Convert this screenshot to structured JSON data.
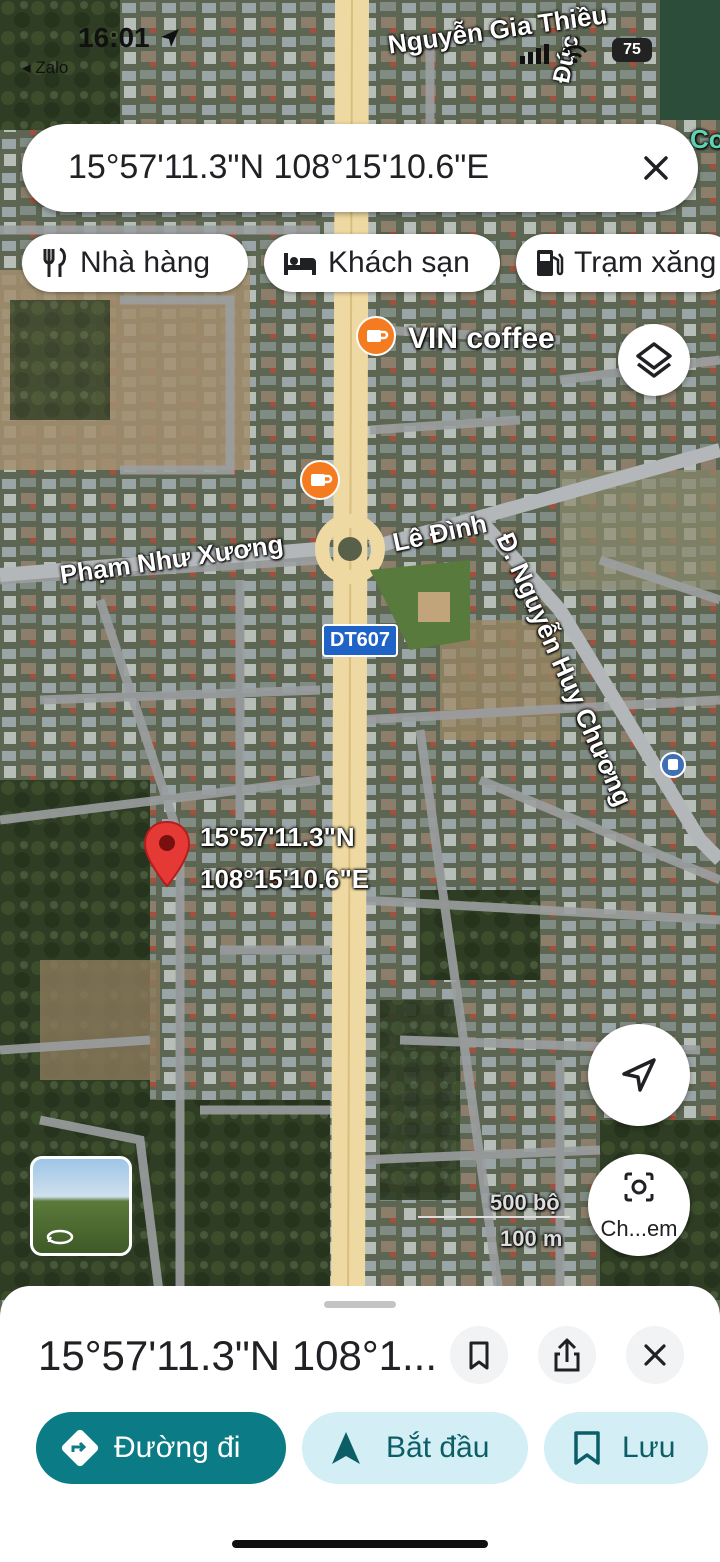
{
  "status_bar": {
    "time": "16:01",
    "back_app": "◂ Zalo",
    "battery": "75"
  },
  "search": {
    "query": "15°57'11.3\"N 108°15'10.6\"E"
  },
  "chips": [
    {
      "label": "Nhà hàng",
      "icon": "restaurant-icon"
    },
    {
      "label": "Khách sạn",
      "icon": "hotel-icon"
    },
    {
      "label": "Trạm xăng",
      "icon": "gas-station-icon"
    }
  ],
  "map": {
    "labels": {
      "street_top": "Nguyễn Gia Thiều",
      "street_top_right": "Đức",
      "street_left": "Phạm Như Xương",
      "street_center": "Lê Đình",
      "street_diagonal": "Đ. Nguyễn Huy Chương",
      "road_badge": "DT607",
      "poi": "VIN coffee",
      "edge_label": "Co",
      "pin_line1": "15°57'11.3\"N",
      "pin_line2": "108°15'10.6\"E",
      "scale_ft": "500 bộ",
      "scale_m": "100 m",
      "lens_label": "Ch...em"
    }
  },
  "sheet": {
    "title": "15°57'11.3\"N 108°1...",
    "actions": {
      "directions": "Đường đi",
      "start": "Bắt đầu",
      "save": "Lưu"
    }
  },
  "colors": {
    "accent_teal": "#0b7b85",
    "light_teal": "#d3eef4",
    "pin_red": "#e53935",
    "coffee_orange": "#f47b20",
    "road_yellow": "#efd9a2"
  }
}
